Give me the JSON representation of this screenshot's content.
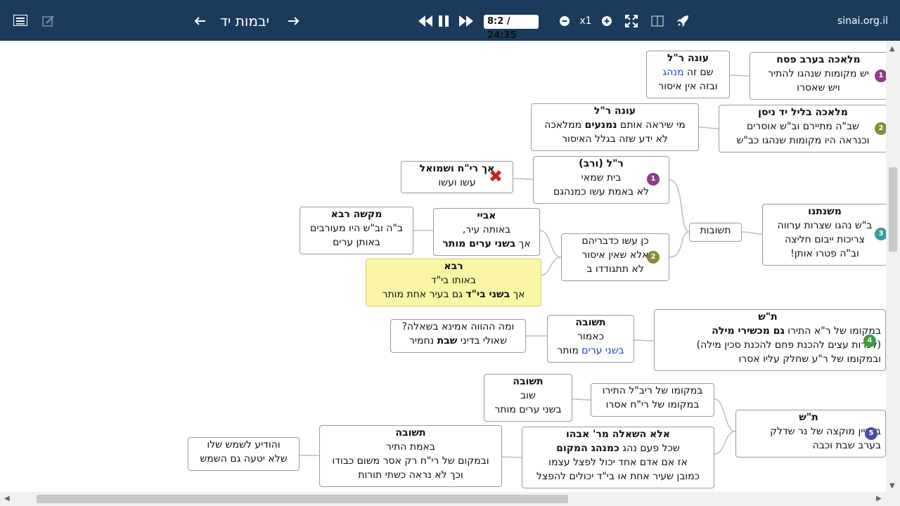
{
  "toolbar": {
    "title": "יבמות יד",
    "time": "8:2 / 24:35",
    "speed": "x1",
    "domain": "sinai.org.il"
  },
  "icons": [
    "list-icon",
    "edit-icon",
    "arrow-left-icon",
    "arrow-right-icon",
    "rewind-icon",
    "pause-icon",
    "fast-forward-icon",
    "minus-icon",
    "plus-icon",
    "fullscreen-icon",
    "split-view-icon",
    "rocket-icon"
  ],
  "nodes": {
    "n1": {
      "title": "מלאכה בערב פסח",
      "l1": "יש מקומות שנהגו להתיר",
      "l2": "ויש שאסרו"
    },
    "n2": {
      "title": "עונה ר\"ל",
      "l1a": "שם זה ",
      "l1b": "מנהג",
      "l2": "ובזה אין איסור"
    },
    "n3": {
      "title": "מלאכה בליל יד ניסן",
      "l1": "שב\"ה מתיירם וב\"ש אוסרים",
      "l2": "וכנראה היו מקומות שנהגו כב\"ש"
    },
    "n4": {
      "title": "עונה ר\"ל",
      "l1a": "מי שיראה אותם ",
      "l1b": "נמנעים",
      "l1c": " ממלאכה",
      "l2": "לא ידע שזה בגלל האיסור"
    },
    "n5": {
      "title": "ר\"ל (ורב)",
      "l1": "בית שמאי",
      "l2": "לא באמת עשו כמנהגם"
    },
    "n6": {
      "title": "אך  רי\"ח ושמואל",
      "l1": "עשו ועשו"
    },
    "n7": {
      "title": "משנתנו",
      "l1": "ב\"ש נהגו שצרות ערווה",
      "l2": "צריכות ייבום חליצה",
      "l3": "וב\"ה פטרו אותן!"
    },
    "n8": {
      "label": "תשובות"
    },
    "n9": {
      "l1": "כן עשו כדבריהם",
      "l2": "אלא שאין איסור",
      "l3": "לא תתגודדו ב"
    },
    "n10": {
      "title": "אביי",
      "l1": "באותה עיר,",
      "l2a": "אך ",
      "l2b": "בשני ערים מותר"
    },
    "n11": {
      "title": "מקשה רבא",
      "l1": "ב\"ה וב\"ש היו מעורבים",
      "l2": "באותן ערים"
    },
    "n12": {
      "title": "רבא",
      "l1": "באותו בי\"ד",
      "l2a": "אך ",
      "l2b": "בשני בי\"ד",
      "l2c": "  גם בעיר אחת מותר"
    },
    "n13": {
      "title": "ת\"ש",
      "l1a": "במקומו של ר\"א התירו ",
      "l1b": "גם מכשירי מילה",
      "l2": "(לכרות עצים להכנת פחם להכנת סכין מילה)",
      "l3": "ובמקומו של ר\"ע שחלק עליו אסרו"
    },
    "n14": {
      "title": "תשובה",
      "l1": "כאמור",
      "l2a": "בשני ערים",
      "l2b": " מותר"
    },
    "n15": {
      "l1": "ומה ההווה אמינא בשאלה?",
      "l2a": "שאולי בדיני ",
      "l2b": "שבת",
      "l2c": "  נחמיר"
    },
    "n16": {
      "title": "ת\"ש",
      "l1": "בעניין מוקצה של נר שדלק",
      "l2": "בערב שבת וכבה"
    },
    "n17": {
      "l1": "במקומו של ריב\"ל התירו",
      "l2": "במקומו של רי\"ח אסרו"
    },
    "n18": {
      "title": "תשובה",
      "l1": "שוב",
      "l2": "בשני ערים מותר"
    },
    "n19": {
      "title": "אלא השאלה מר' אבהו",
      "l1a": "שכל פעם נהג ",
      "l1b": "כמנהג המקום",
      "l2": "אז אם אדם אחד יכול לפצל עצמו",
      "l3": "כמובן שעיר אחת או בי\"ד יכולים להפצל"
    },
    "n20": {
      "title": "תשובה",
      "l1": "באמת התיר",
      "l2": "ובמקום של רי\"ח רק אסר משום כבודו",
      "l3": "וכך לא נראה כשתי תורות"
    },
    "n21": {
      "l1": "והודיע לשמש שלו",
      "l2": "שלא יטעה גם השמש"
    }
  },
  "badges": [
    {
      "key": "b1",
      "num": "1",
      "color": "#8e3a8e"
    },
    {
      "key": "b2",
      "num": "2",
      "color": "#8a8a3a"
    },
    {
      "key": "b3",
      "num": "1",
      "color": "#8e3a8e"
    },
    {
      "key": "b4",
      "num": "2",
      "color": "#8a8a3a"
    },
    {
      "key": "b5",
      "num": "3",
      "color": "#3a9a9a"
    },
    {
      "key": "b6",
      "num": "4",
      "color": "#3aa03a"
    },
    {
      "key": "b7",
      "num": "5",
      "color": "#4a4aa8"
    }
  ],
  "colors": {
    "topbar": "#1b3a5c",
    "highlight": "#fbf6a6",
    "blue_text": "#1a3fbf",
    "x_mark": "#d21e1e"
  }
}
